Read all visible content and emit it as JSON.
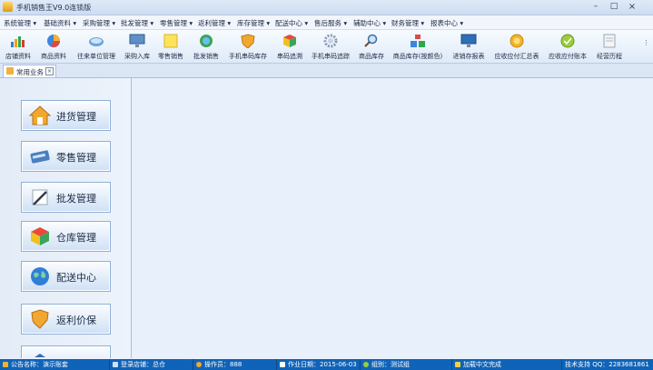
{
  "window": {
    "title": "手机销售王V9.0连锁版"
  },
  "menu": [
    "系统管理",
    "基础资料",
    "采购管理",
    "批发管理",
    "零售管理",
    "返利管理",
    "库存管理",
    "配送中心",
    "售后服务",
    "辅助中心",
    "财务管理",
    "报表中心"
  ],
  "toolbar": [
    {
      "label": "店铺资料",
      "icon": "bar-chart-icon"
    },
    {
      "label": "商品资料",
      "icon": "pie-chart-icon"
    },
    {
      "label": "往来单位管理",
      "icon": "disk-icon"
    },
    {
      "label": "采购入库",
      "icon": "monitor-icon"
    },
    {
      "label": "零售销售",
      "icon": "note-icon"
    },
    {
      "label": "批发销售",
      "icon": "refresh-icon"
    },
    {
      "label": "手机串码库存",
      "icon": "shield-icon"
    },
    {
      "label": "串码追溯",
      "icon": "cube-icon"
    },
    {
      "label": "手机串码追踪",
      "icon": "gear-icon"
    },
    {
      "label": "商品库存",
      "icon": "magnifier-icon"
    },
    {
      "label": "商品库存(按颜色)",
      "icon": "blocks-icon"
    },
    {
      "label": "进销存报表",
      "icon": "monitor-report-icon"
    },
    {
      "label": "应收应付汇总表",
      "icon": "coin-icon"
    },
    {
      "label": "应收应付账本",
      "icon": "check-icon"
    },
    {
      "label": "经营历程",
      "icon": "document-icon"
    }
  ],
  "tab": {
    "label": "常用业务"
  },
  "modules": [
    {
      "label": "进货管理",
      "icon": "house-icon"
    },
    {
      "label": "零售管理",
      "icon": "card-icon"
    },
    {
      "label": "批发管理",
      "icon": "pen-icon"
    },
    {
      "label": "仓库管理",
      "icon": "cube-icon"
    },
    {
      "label": "配送中心",
      "icon": "globe-icon"
    },
    {
      "label": "返利价保",
      "icon": "shield-icon"
    }
  ],
  "status": [
    {
      "text": "公告名称：演示账套"
    },
    {
      "text": "登录店铺：总仓"
    },
    {
      "text": "操作员：888"
    },
    {
      "text": "作业日期：2015-06-03"
    },
    {
      "text": "组别：测试组"
    },
    {
      "text": "加载中文完成"
    },
    {
      "text": "技术支持 QQ：2283681861"
    }
  ]
}
